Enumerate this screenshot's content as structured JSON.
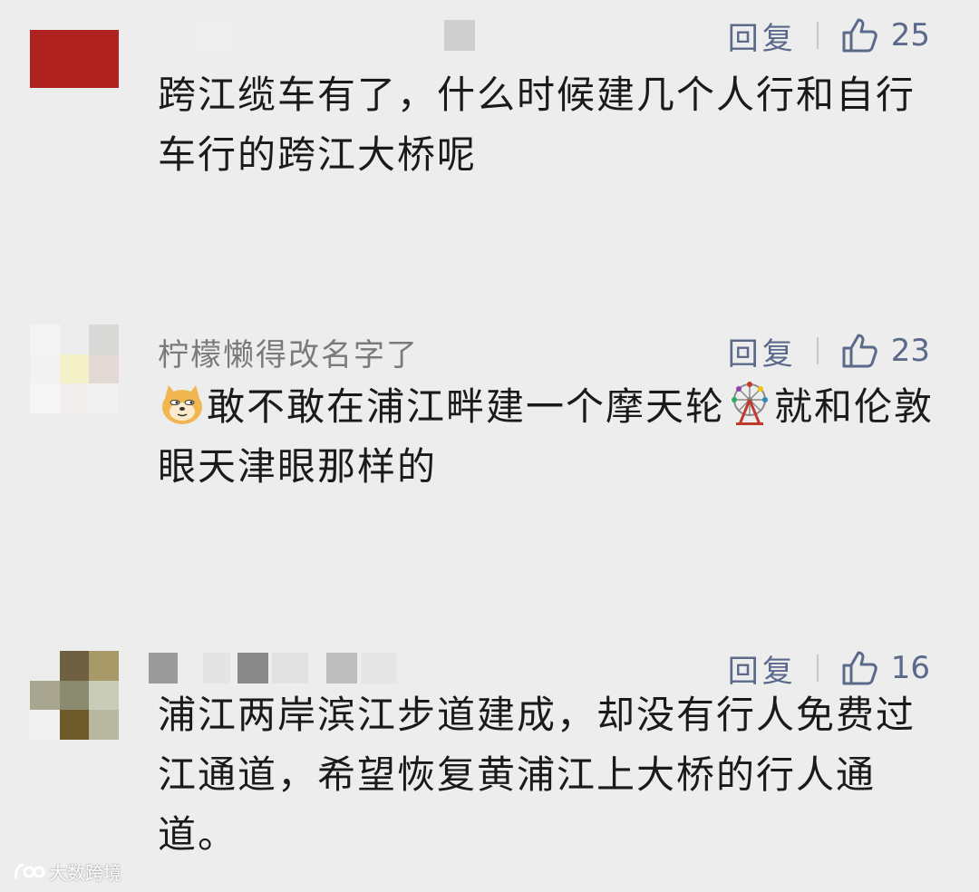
{
  "comments": [
    {
      "username": "",
      "reply_label": "回复",
      "likes": "25",
      "text": "跨江缆车有了，什么时候建几个人行和自行车行的跨江大桥呢"
    },
    {
      "username": "柠檬懒得改名字了",
      "reply_label": "回复",
      "likes": "23",
      "text_part1": "敢不敢在浦江畔建一个摩天轮",
      "text_part2": "就和伦敦眼天津眼那样的"
    },
    {
      "username": "",
      "reply_label": "回复",
      "likes": "16",
      "text": "浦江两岸滨江步道建成，却没有行人免费过江通道，希望恢复黄浦江上大桥的行人通道。"
    }
  ],
  "icons": {
    "like": "thumbs-up-icon",
    "emoji_doge": "doge-emoji-icon",
    "emoji_ferris": "ferris-wheel-emoji-icon"
  },
  "colors": {
    "background": "#ededed",
    "link": "#5b6a8a",
    "text": "#1a1a1a",
    "username": "#7a7a7a"
  },
  "watermark": "大数跨境"
}
